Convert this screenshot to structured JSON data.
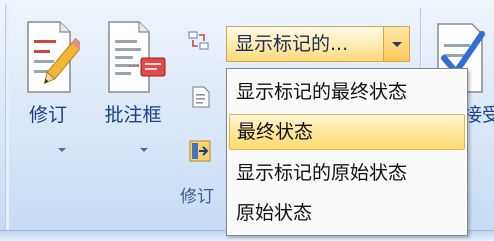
{
  "ribbon": {
    "group_label": "修订",
    "buttons": {
      "track_changes": "修订",
      "balloons": "批注框",
      "accept": "接受"
    },
    "display_combo": {
      "value": "显示标记的..."
    },
    "display_menu": {
      "items": [
        "显示标记的最终状态",
        "最终状态",
        "显示标记的原始状态",
        "原始状态"
      ],
      "selected_index": 1
    }
  },
  "colors": {
    "ribbon_bg": "#dde9f8",
    "label_text": "#15428b",
    "highlight": "#ffe69a"
  }
}
